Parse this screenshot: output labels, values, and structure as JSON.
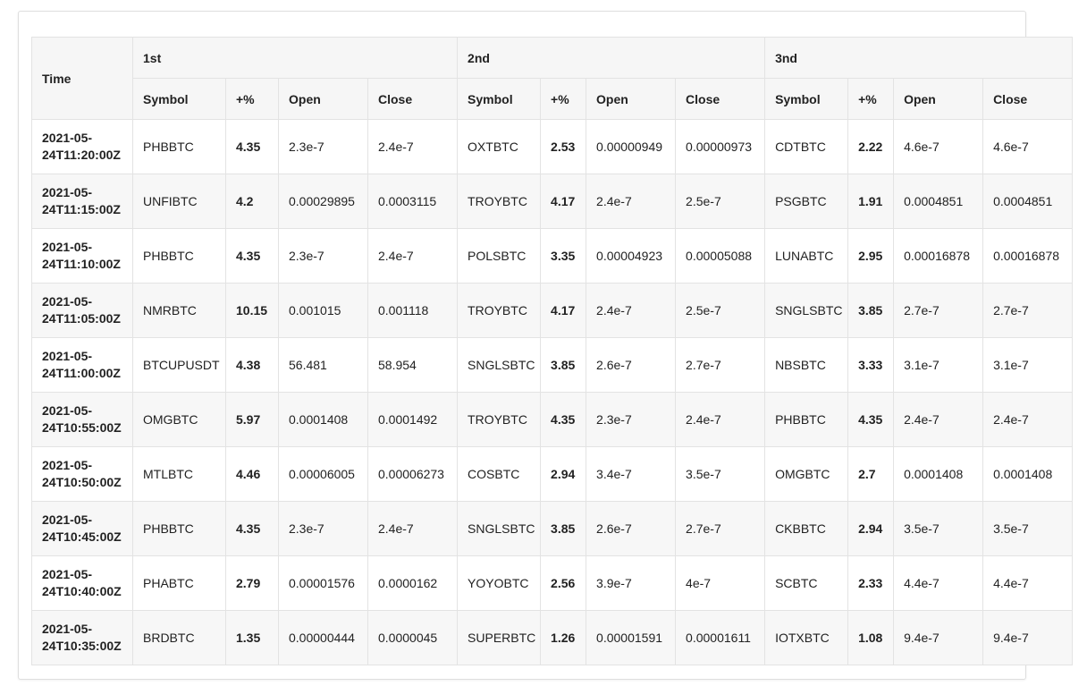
{
  "table": {
    "time_header": "Time",
    "groups": [
      "1st",
      "2nd",
      "3nd"
    ],
    "sub_headers": [
      "Symbol",
      "+%",
      "Open",
      "Close"
    ],
    "rows": [
      {
        "time": "2021-05-24T11:20:00Z",
        "cells": [
          [
            "PHBBTC",
            "4.35",
            "2.3e-7",
            "2.4e-7"
          ],
          [
            "OXTBTC",
            "2.53",
            "0.00000949",
            "0.00000973"
          ],
          [
            "CDTBTC",
            "2.22",
            "4.6e-7",
            "4.6e-7"
          ]
        ]
      },
      {
        "time": "2021-05-24T11:15:00Z",
        "cells": [
          [
            "UNFIBTC",
            "4.2",
            "0.00029895",
            "0.0003115"
          ],
          [
            "TROYBTC",
            "4.17",
            "2.4e-7",
            "2.5e-7"
          ],
          [
            "PSGBTC",
            "1.91",
            "0.0004851",
            "0.0004851"
          ]
        ]
      },
      {
        "time": "2021-05-24T11:10:00Z",
        "cells": [
          [
            "PHBBTC",
            "4.35",
            "2.3e-7",
            "2.4e-7"
          ],
          [
            "POLSBTC",
            "3.35",
            "0.00004923",
            "0.00005088"
          ],
          [
            "LUNABTC",
            "2.95",
            "0.00016878",
            "0.00016878"
          ]
        ]
      },
      {
        "time": "2021-05-24T11:05:00Z",
        "cells": [
          [
            "NMRBTC",
            "10.15",
            "0.001015",
            "0.001118"
          ],
          [
            "TROYBTC",
            "4.17",
            "2.4e-7",
            "2.5e-7"
          ],
          [
            "SNGLSBTC",
            "3.85",
            "2.7e-7",
            "2.7e-7"
          ]
        ]
      },
      {
        "time": "2021-05-24T11:00:00Z",
        "cells": [
          [
            "BTCUPUSDT",
            "4.38",
            "56.481",
            "58.954"
          ],
          [
            "SNGLSBTC",
            "3.85",
            "2.6e-7",
            "2.7e-7"
          ],
          [
            "NBSBTC",
            "3.33",
            "3.1e-7",
            "3.1e-7"
          ]
        ]
      },
      {
        "time": "2021-05-24T10:55:00Z",
        "cells": [
          [
            "OMGBTC",
            "5.97",
            "0.0001408",
            "0.0001492"
          ],
          [
            "TROYBTC",
            "4.35",
            "2.3e-7",
            "2.4e-7"
          ],
          [
            "PHBBTC",
            "4.35",
            "2.4e-7",
            "2.4e-7"
          ]
        ]
      },
      {
        "time": "2021-05-24T10:50:00Z",
        "cells": [
          [
            "MTLBTC",
            "4.46",
            "0.00006005",
            "0.00006273"
          ],
          [
            "COSBTC",
            "2.94",
            "3.4e-7",
            "3.5e-7"
          ],
          [
            "OMGBTC",
            "2.7",
            "0.0001408",
            "0.0001408"
          ]
        ]
      },
      {
        "time": "2021-05-24T10:45:00Z",
        "cells": [
          [
            "PHBBTC",
            "4.35",
            "2.3e-7",
            "2.4e-7"
          ],
          [
            "SNGLSBTC",
            "3.85",
            "2.6e-7",
            "2.7e-7"
          ],
          [
            "CKBBTC",
            "2.94",
            "3.5e-7",
            "3.5e-7"
          ]
        ]
      },
      {
        "time": "2021-05-24T10:40:00Z",
        "cells": [
          [
            "PHABTC",
            "2.79",
            "0.00001576",
            "0.0000162"
          ],
          [
            "YOYOBTC",
            "2.56",
            "3.9e-7",
            "4e-7"
          ],
          [
            "SCBTC",
            "2.33",
            "4.4e-7",
            "4.4e-7"
          ]
        ]
      },
      {
        "time": "2021-05-24T10:35:00Z",
        "cells": [
          [
            "BRDBTC",
            "1.35",
            "0.00000444",
            "0.0000045"
          ],
          [
            "SUPERBTC",
            "1.26",
            "0.00001591",
            "0.00001611"
          ],
          [
            "IOTXBTC",
            "1.08",
            "9.4e-7",
            "9.4e-7"
          ]
        ]
      }
    ]
  }
}
